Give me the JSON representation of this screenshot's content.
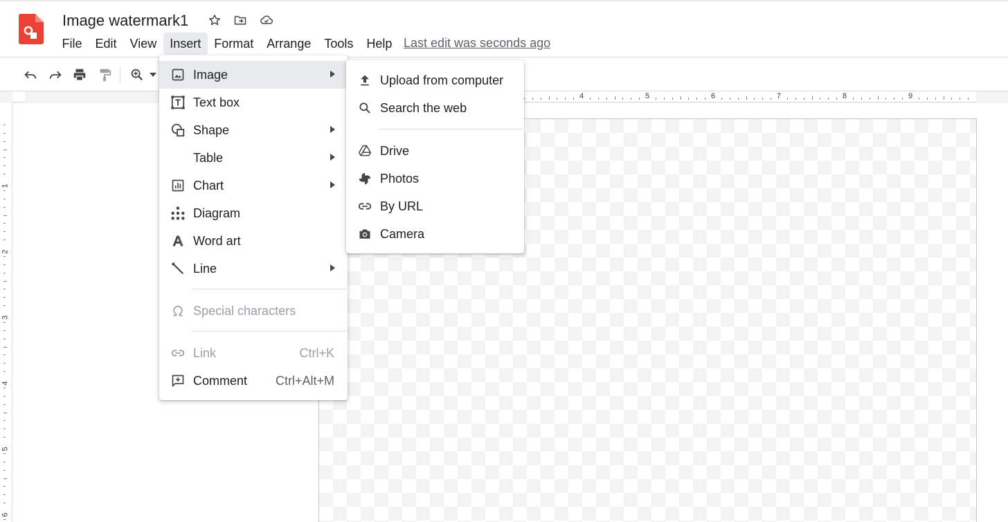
{
  "document": {
    "title": "Image watermark1",
    "last_edit": "Last edit was seconds ago"
  },
  "header_icons": [
    "star-icon",
    "move-to-folder-icon",
    "cloud-saved-icon"
  ],
  "menubar": {
    "items": [
      "File",
      "Edit",
      "View",
      "Insert",
      "Format",
      "Arrange",
      "Tools",
      "Help"
    ],
    "active": "Insert"
  },
  "toolbar": {
    "buttons": [
      "undo-icon",
      "redo-icon",
      "print-icon",
      "paint-format-icon",
      "zoom-icon"
    ]
  },
  "ruler": {
    "horizontal_labels": [
      "4",
      "5",
      "6",
      "7",
      "8",
      "9"
    ],
    "vertical_labels": [
      "1",
      "2",
      "3",
      "4",
      "5",
      "6"
    ]
  },
  "insert_menu": {
    "items": [
      {
        "label": "Image",
        "icon": "image-icon",
        "submenu": true,
        "highlighted": true
      },
      {
        "label": "Text box",
        "icon": "text-box-icon",
        "submenu": false
      },
      {
        "label": "Shape",
        "icon": "shape-icon",
        "submenu": true
      },
      {
        "label": "Table",
        "icon": "",
        "submenu": true
      },
      {
        "label": "Chart",
        "icon": "chart-icon",
        "submenu": true
      },
      {
        "label": "Diagram",
        "icon": "diagram-icon",
        "submenu": false
      },
      {
        "label": "Word art",
        "icon": "word-art-icon",
        "submenu": false
      },
      {
        "label": "Line",
        "icon": "line-icon",
        "submenu": true
      },
      {
        "label": "Special characters",
        "icon": "omega-icon",
        "disabled": true
      },
      {
        "label": "Link",
        "icon": "link-icon",
        "shortcut": "Ctrl+K",
        "disabled": true
      },
      {
        "label": "Comment",
        "icon": "comment-icon",
        "shortcut": "Ctrl+Alt+M"
      }
    ]
  },
  "image_submenu": {
    "items": [
      {
        "label": "Upload from computer",
        "icon": "upload-icon"
      },
      {
        "label": "Search the web",
        "icon": "search-icon"
      },
      {
        "label": "Drive",
        "icon": "drive-icon"
      },
      {
        "label": "Photos",
        "icon": "photos-icon"
      },
      {
        "label": "By URL",
        "icon": "link-icon"
      },
      {
        "label": "Camera",
        "icon": "camera-icon"
      }
    ]
  },
  "colors": {
    "brand": "#ea4335",
    "menu_highlight": "#e8eaed",
    "icon": "#444746",
    "disabled": "#9aa0a6"
  }
}
